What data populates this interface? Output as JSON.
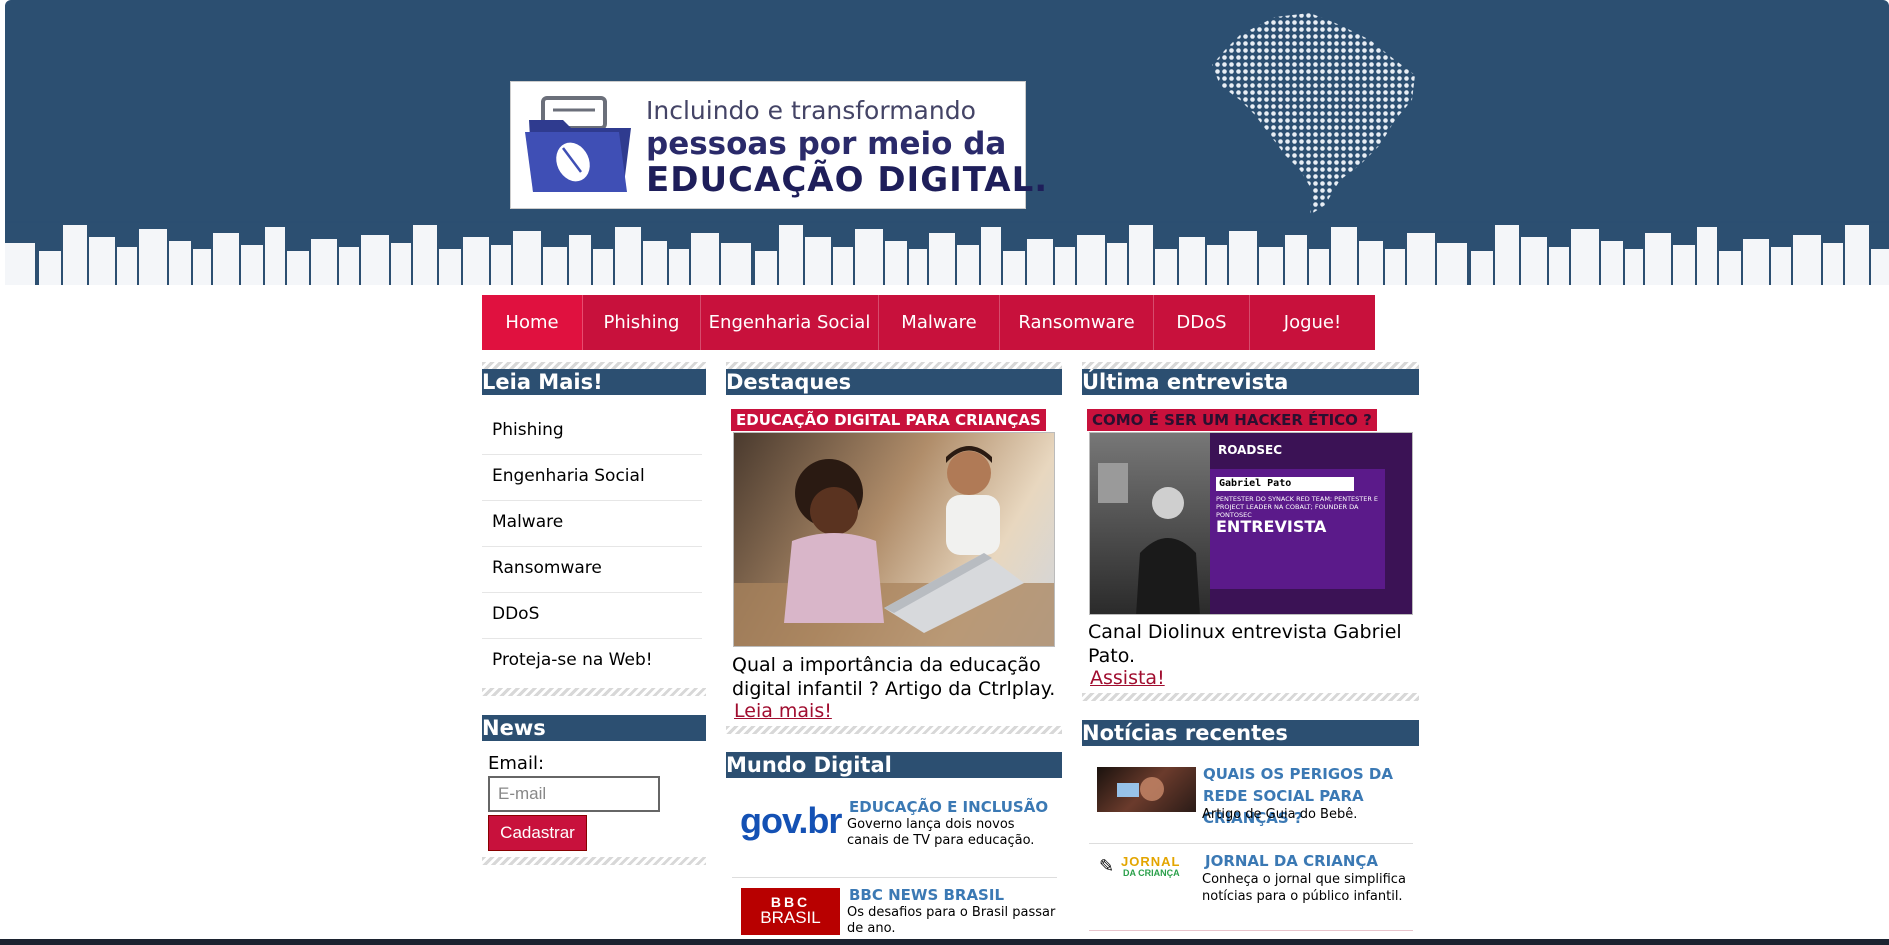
{
  "header": {
    "banner_line1": "Incluindo e transformando",
    "banner_line2": "pessoas por meio da",
    "banner_line3": "EDUCAÇÃO DIGITAL."
  },
  "nav": {
    "items": [
      {
        "label": "Home",
        "active": true
      },
      {
        "label": "Phishing",
        "active": false
      },
      {
        "label": "Engenharia Social",
        "active": false
      },
      {
        "label": "Malware",
        "active": false
      },
      {
        "label": "Ransomware",
        "active": false
      },
      {
        "label": "DDoS",
        "active": false
      },
      {
        "label": "Jogue!",
        "active": false
      }
    ]
  },
  "leia_mais": {
    "title": "Leia Mais!",
    "items": [
      "Phishing",
      "Engenharia Social",
      "Malware",
      "Ransomware",
      "DDoS",
      "Proteja-se na Web!"
    ]
  },
  "news": {
    "title": "News",
    "email_label": "Email:",
    "email_placeholder": "E-mail",
    "submit_label": "Cadastrar"
  },
  "destaques": {
    "title": "Destaques",
    "tag": "EDUCAÇÃO DIGITAL PARA CRIANÇAS",
    "caption": "Qual a importância da educação digital infantil ? Artigo da Ctrlplay.",
    "link": "Leia mais!"
  },
  "mundo_digital": {
    "title": "Mundo Digital",
    "items": [
      {
        "logo": "gov.br",
        "title": "EDUCAÇÃO E INCLUSÃO",
        "text": "Governo lança dois novos canais de TV para educação."
      },
      {
        "logo_top": "BBC",
        "logo_bottom": "BRASIL",
        "title": "BBC NEWS BRASIL",
        "text": "Os desafios para o Brasil passar de ano."
      }
    ]
  },
  "entrevista": {
    "title": "Última entrevista",
    "tag": "COMO É SER UM HACKER ÉTICO ?",
    "image_brand": "ROADSEC",
    "image_name": "Gabriel Pato",
    "image_role": "PENTESTER DO SYNACK RED TEAM; PENTESTER E PROJECT LEADER NA COBALT; FOUNDER DA PONTOSEC",
    "image_word": "ENTREVISTA",
    "caption": "Canal Diolinux entrevista Gabriel Pato.",
    "link": "Assista!"
  },
  "noticias": {
    "title": "Notícias recentes",
    "items": [
      {
        "title": "QUAIS OS PERIGOS DA REDE SOCIAL PARA CRIANÇAS ?",
        "text": "Artigo de Guia do Bebê."
      },
      {
        "logo_top": "JORNAL",
        "logo_bottom": "DA CRIANÇA",
        "title": "JORNAL DA CRIANÇA",
        "text": "Conheça o jornal que simplifica notícias para o público infantil."
      }
    ]
  },
  "colors": {
    "navy": "#2c4f71",
    "crimson": "#c8113c",
    "link_blue": "#3b79b4"
  }
}
